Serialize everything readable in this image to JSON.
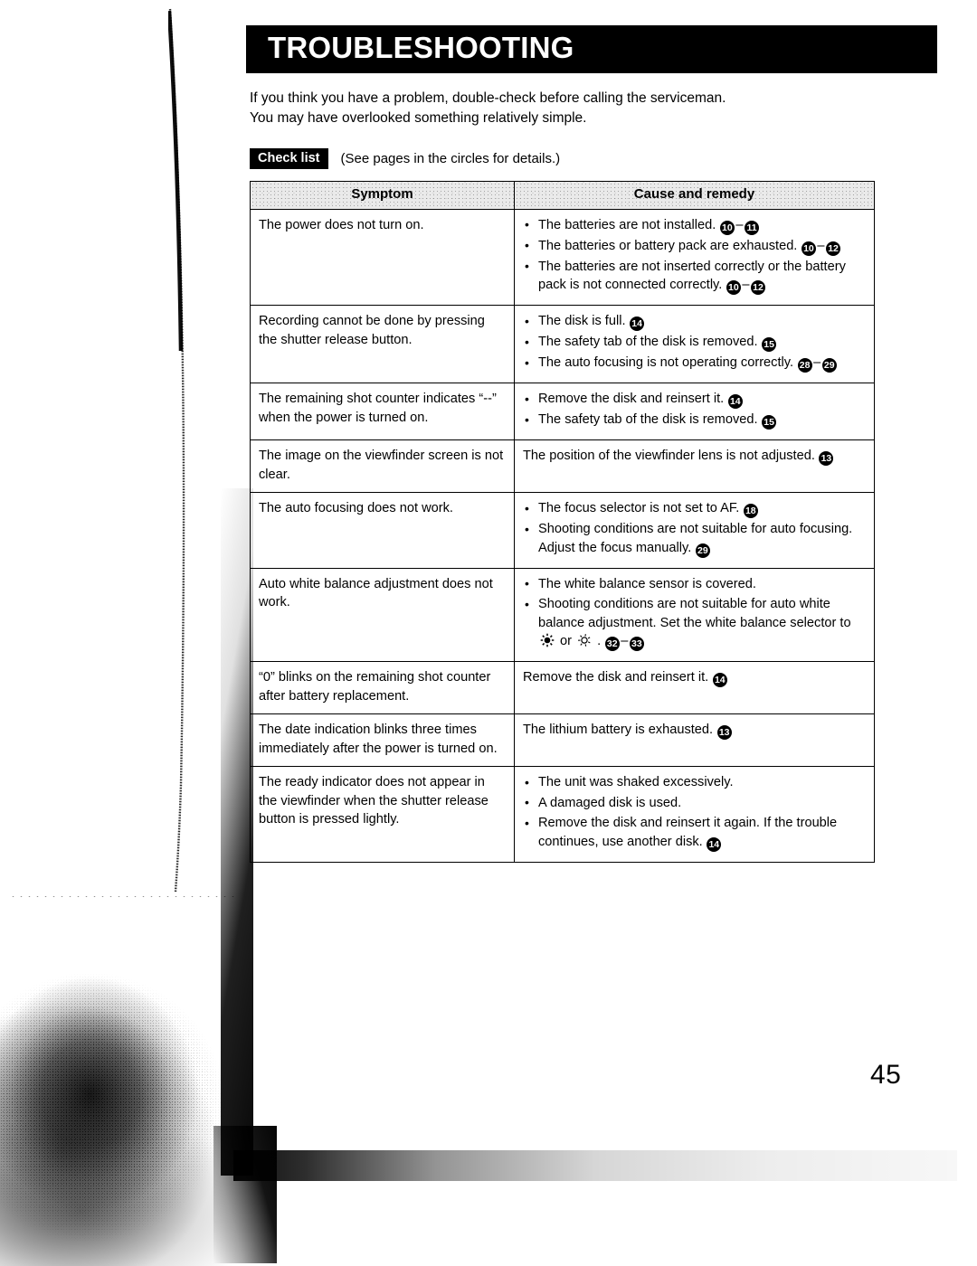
{
  "header": {
    "title": "TROUBLESHOOTING"
  },
  "intro": {
    "line1": "If you think you have a problem, double-check before calling the serviceman.",
    "line2": "You may have overlooked something relatively simple."
  },
  "checklist": {
    "badge": "Check list",
    "note": "(See pages in the circles for details.)"
  },
  "table": {
    "columns": [
      "Symptom",
      "Cause and remedy"
    ],
    "rows": [
      {
        "symptom": "The power does not turn on.",
        "bulleted": true,
        "causes": [
          {
            "text": "The batteries are not installed.",
            "refs": [
              "10",
              "11"
            ]
          },
          {
            "text": "The batteries or battery pack are exhausted.",
            "refs": [
              "10",
              "12"
            ]
          },
          {
            "text": "The batteries are not inserted correctly or the battery pack is not connected correctly.",
            "refs": [
              "10",
              "12"
            ]
          }
        ]
      },
      {
        "symptom": "Recording cannot be done by pressing the shutter release button.",
        "bulleted": true,
        "causes": [
          {
            "text": "The disk is full.",
            "refs": [
              "14"
            ]
          },
          {
            "text": "The safety tab of the disk is removed.",
            "refs": [
              "15"
            ]
          },
          {
            "text": "The auto focusing is not operating correctly.",
            "refs": [
              "28",
              "29"
            ]
          }
        ]
      },
      {
        "symptom": "The remaining shot counter indicates “--” when the power is turned on.",
        "bulleted": true,
        "causes": [
          {
            "text": "Remove the disk and reinsert it.",
            "refs": [
              "14"
            ]
          },
          {
            "text": "The safety tab of the disk is removed.",
            "refs": [
              "15"
            ]
          }
        ]
      },
      {
        "symptom": "The image on the viewfinder screen is not clear.",
        "bulleted": false,
        "causes": [
          {
            "text": "The position of the viewfinder lens is not adjusted.",
            "refs": [
              "13"
            ]
          }
        ]
      },
      {
        "symptom": "The auto focusing does not work.",
        "bulleted": true,
        "causes": [
          {
            "text": "The focus selector is not set to AF.",
            "refs": [
              "18"
            ]
          },
          {
            "text": "Shooting conditions are not suitable for auto focusing. Adjust the focus manually.",
            "refs": [
              "29"
            ]
          }
        ]
      },
      {
        "symptom": "Auto white balance adjustment does not work.",
        "bulleted": true,
        "causes": [
          {
            "text": "The white balance sensor is covered.",
            "refs": []
          },
          {
            "text": "Shooting conditions are not suitable for auto white balance adjustment. Set the white balance selector to",
            "symbols": [
              "sun-bright-icon",
              "or",
              "sun-dim-icon",
              "."
            ],
            "refs": [
              "32",
              "33"
            ]
          }
        ]
      },
      {
        "symptom": "“0” blinks on the remaining shot counter after battery replacement.",
        "bulleted": false,
        "causes": [
          {
            "text": "Remove the disk and reinsert it.",
            "refs": [
              "14"
            ]
          }
        ]
      },
      {
        "symptom": "The date indication blinks three times immediately after the power is turned on.",
        "bulleted": false,
        "causes": [
          {
            "text": "The lithium battery is exhausted.",
            "refs": [
              "13"
            ]
          }
        ]
      },
      {
        "symptom": "The ready indicator does not appear in the viewfinder when the shutter release button is pressed lightly.",
        "bulleted": true,
        "causes": [
          {
            "text": "The unit was shaked excessively.",
            "refs": []
          },
          {
            "text": "A damaged disk is used.",
            "refs": []
          },
          {
            "text": "Remove the disk and reinsert it again. If the trouble continues, use another disk.",
            "refs": [
              "14"
            ]
          }
        ]
      }
    ]
  },
  "footer": {
    "page_number": "45"
  }
}
